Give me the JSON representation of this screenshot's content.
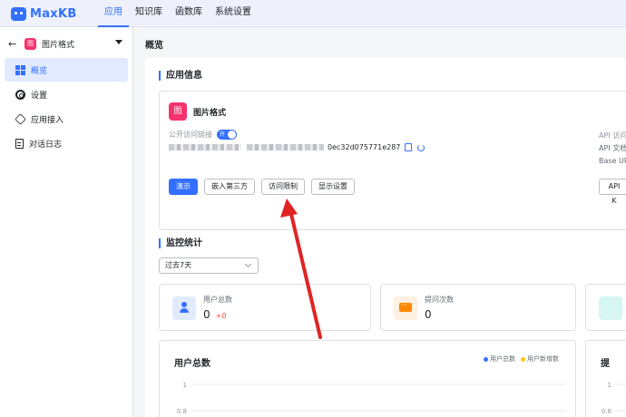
{
  "brand": {
    "name": "MaxKB"
  },
  "topnav": [
    {
      "label": "应用",
      "active": true
    },
    {
      "label": "知识库"
    },
    {
      "label": "函数库"
    },
    {
      "label": "系统设置"
    }
  ],
  "sidebar": {
    "app_name": "图片格式",
    "app_badge": "图",
    "items": [
      {
        "label": "概览",
        "icon": "grid-icon",
        "active": true
      },
      {
        "label": "设置",
        "icon": "gear-icon"
      },
      {
        "label": "应用接入",
        "icon": "cube-icon"
      },
      {
        "label": "对话日志",
        "icon": "log-icon"
      }
    ]
  },
  "page": {
    "title": "概览"
  },
  "app_info": {
    "section_title": "应用信息",
    "badge": "图",
    "name": "图片格式",
    "public_link_label": "公开访问链接",
    "toggle_label": "开",
    "link_suffix": "0ec32d075771e287",
    "api": {
      "line1": "API 访问",
      "line2": "API 文档",
      "line3": "Base UR"
    },
    "buttons": {
      "demo": "演示",
      "embed": "嵌入第三方",
      "access": "访问限制",
      "display": "显示设置",
      "api_key": "API K"
    }
  },
  "monitor": {
    "section_title": "监控统计",
    "range": "过去7天",
    "stats": [
      {
        "label": "用户总数",
        "value": "0",
        "delta": "+0",
        "icon": "user-icon",
        "color": "#3370ff"
      },
      {
        "label": "提问次数",
        "value": "0",
        "icon": "message-icon",
        "color": "#ff8800"
      }
    ]
  },
  "chart_data": {
    "type": "line",
    "title": "用户总数",
    "y_ticks": [
      "1",
      "0.8",
      "0.6"
    ],
    "ylim": [
      0,
      1
    ],
    "series": [
      {
        "name": "用户总数",
        "color": "#3370ff",
        "values": []
      },
      {
        "name": "用户新增数",
        "color": "#ffc60a",
        "values": []
      }
    ]
  },
  "chart2": {
    "title": "提",
    "y_ticks": [
      "1",
      "0.8",
      "0.6"
    ]
  }
}
